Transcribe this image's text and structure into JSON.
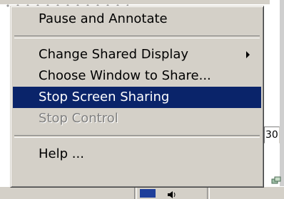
{
  "background": {
    "partial_field_text": "30"
  },
  "menu": {
    "items": [
      {
        "label": "Pause and Annotate",
        "state": "normal"
      },
      {
        "label": "Change Shared Display",
        "state": "normal",
        "has_submenu": true
      },
      {
        "label": "Choose Window to Share...",
        "state": "normal"
      },
      {
        "label": "Stop Screen Sharing",
        "state": "highlighted"
      },
      {
        "label": "Stop Control",
        "state": "disabled"
      },
      {
        "label": "Help ...",
        "state": "normal"
      }
    ]
  },
  "colors": {
    "menu_background": "#d4d0c8",
    "highlight": "#0a246a",
    "highlight_text": "#ffffff",
    "disabled_text": "#808080"
  }
}
